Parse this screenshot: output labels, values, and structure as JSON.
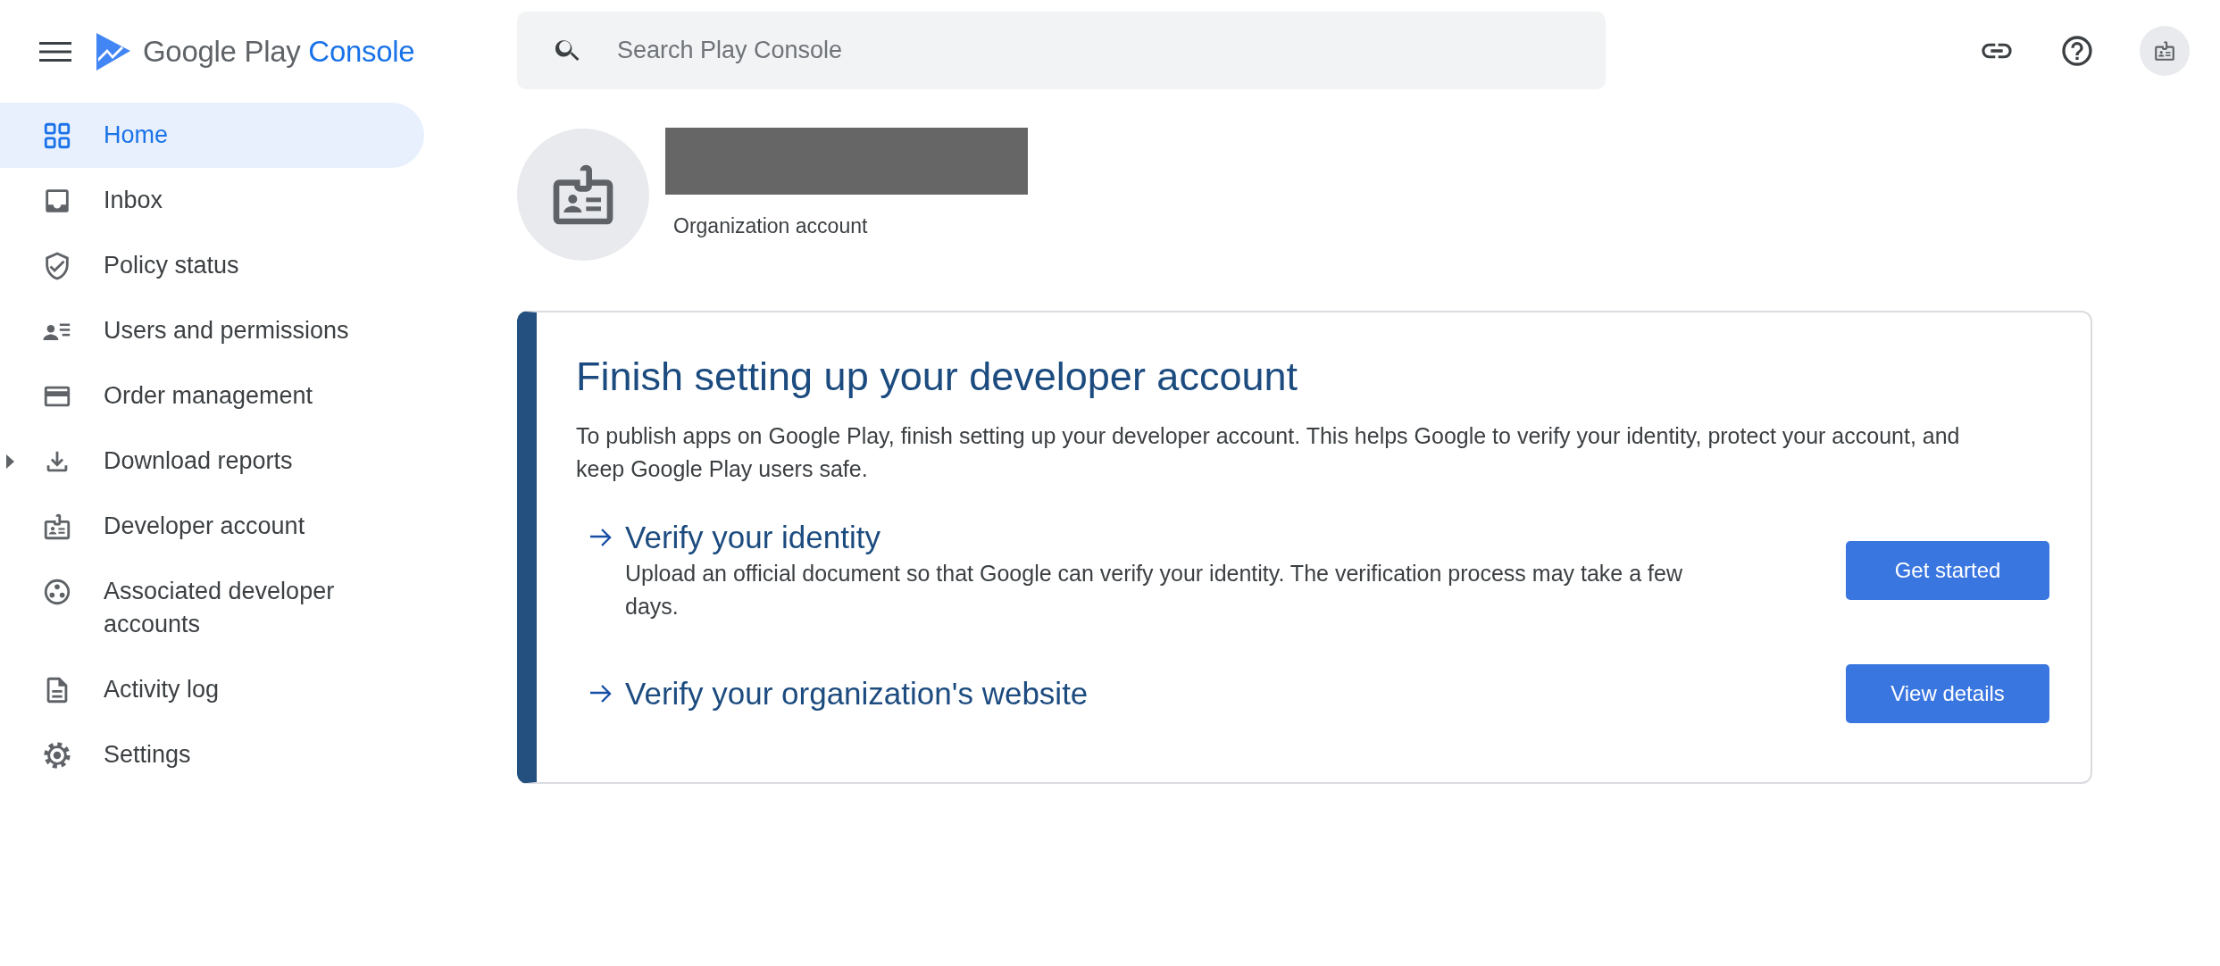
{
  "app": {
    "brand_word_1": "Google Play",
    "brand_word_2": "Console"
  },
  "sidebar": {
    "items": [
      {
        "label": "Home",
        "selected": true,
        "has_children": false
      },
      {
        "label": "Inbox",
        "selected": false,
        "has_children": false
      },
      {
        "label": "Policy status",
        "selected": false,
        "has_children": false
      },
      {
        "label": "Users and permissions",
        "selected": false,
        "has_children": false
      },
      {
        "label": "Order management",
        "selected": false,
        "has_children": false
      },
      {
        "label": "Download reports",
        "selected": false,
        "has_children": true
      },
      {
        "label": "Developer account",
        "selected": false,
        "has_children": false
      },
      {
        "label": "Associated developer accounts",
        "selected": false,
        "has_children": false
      },
      {
        "label": "Activity log",
        "selected": false,
        "has_children": false
      },
      {
        "label": "Settings",
        "selected": false,
        "has_children": false
      }
    ]
  },
  "search": {
    "placeholder": "Search Play Console"
  },
  "account": {
    "type": "Organization account"
  },
  "setup_card": {
    "title": "Finish setting up your developer account",
    "description": "To publish apps on Google Play, finish setting up your developer account. This helps Google to verify your identity, protect your account, and keep Google Play users safe.",
    "steps": [
      {
        "title": "Verify your identity",
        "description": "Upload an official document so that Google can verify your identity. The verification process may take a few days.",
        "button": "Get started"
      },
      {
        "title": "Verify your organization's website",
        "button": "View details"
      }
    ]
  }
}
